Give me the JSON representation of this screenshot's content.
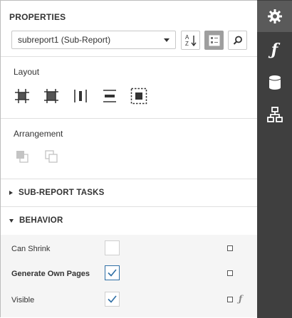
{
  "panel": {
    "title": "PROPERTIES",
    "component_select": "subreport1 (Sub-Report)"
  },
  "toolbar": {
    "sort_alpha_icon": "sort-alphabetical-icon",
    "categories_icon": "categorized-view-icon",
    "search_icon": "search-icon"
  },
  "layout": {
    "label": "Layout",
    "buttons": [
      "align-to-grid",
      "size-to-grid",
      "center-horizontally",
      "center-vertically",
      "fit-bounds-to-container"
    ]
  },
  "arrangement": {
    "label": "Arrangement",
    "buttons": [
      "bring-to-front",
      "send-to-back"
    ]
  },
  "groups": {
    "tasks": "SUB-REPORT TASKS",
    "behavior": "BEHAVIOR"
  },
  "properties": [
    {
      "name": "Can Shrink",
      "checked": false,
      "bold": false
    },
    {
      "name": "Generate Own Pages",
      "checked": true,
      "bold": true
    },
    {
      "name": "Visible",
      "checked": true,
      "bold": false
    }
  ],
  "rail": [
    "gear-icon",
    "function-icon",
    "database-icon",
    "hierarchy-icon"
  ],
  "colors": {
    "rail_bg": "#3f3f3f",
    "rail_active": "#5a5a5a",
    "check_blue": "#2f6fa5",
    "props_bg": "#f5f5f5"
  }
}
